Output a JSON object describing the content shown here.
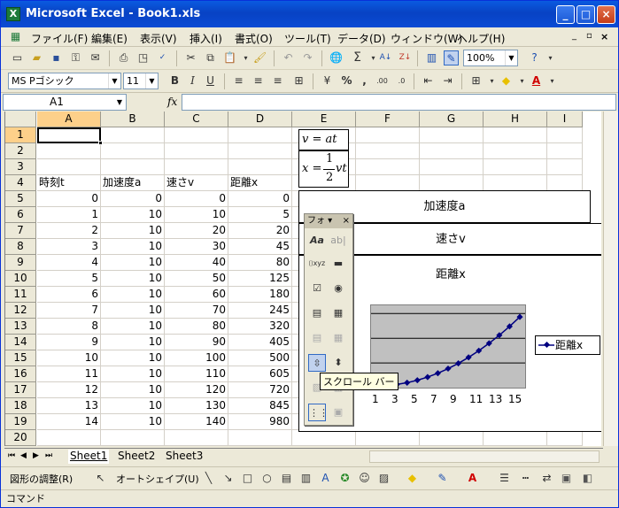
{
  "window": {
    "title": "Microsoft Excel - Book1.xls"
  },
  "menu": [
    "ファイル(F)",
    "編集(E)",
    "表示(V)",
    "挿入(I)",
    "書式(O)",
    "ツール(T)",
    "データ(D)",
    "ウィンドウ(W)",
    "ヘルプ(H)"
  ],
  "toolbar": {
    "zoom": "100%",
    "font": "MS Pゴシック",
    "size": "11"
  },
  "namebox": "A1",
  "fx_label": "fx",
  "columns": [
    "A",
    "B",
    "C",
    "D",
    "E",
    "F",
    "G",
    "H",
    "I"
  ],
  "rows": [
    "1",
    "2",
    "3",
    "4",
    "5",
    "6",
    "7",
    "8",
    "9",
    "10",
    "11",
    "12",
    "13",
    "14",
    "15",
    "16",
    "17",
    "18",
    "19",
    "20"
  ],
  "table": {
    "headers": [
      "時刻t",
      "加速度a",
      "速さv",
      "距離x"
    ],
    "data": [
      [
        0,
        0,
        0,
        0
      ],
      [
        1,
        10,
        10,
        5
      ],
      [
        2,
        10,
        20,
        20
      ],
      [
        3,
        10,
        30,
        45
      ],
      [
        4,
        10,
        40,
        80
      ],
      [
        5,
        10,
        50,
        125
      ],
      [
        6,
        10,
        60,
        180
      ],
      [
        7,
        10,
        70,
        245
      ],
      [
        8,
        10,
        80,
        320
      ],
      [
        9,
        10,
        90,
        405
      ],
      [
        10,
        10,
        100,
        500
      ],
      [
        11,
        10,
        110,
        605
      ],
      [
        12,
        10,
        120,
        720
      ],
      [
        13,
        10,
        130,
        845
      ],
      [
        14,
        10,
        140,
        980
      ]
    ]
  },
  "equations": {
    "v": "v = at",
    "x_left": "x =",
    "x_num": "1",
    "x_den": "2",
    "x_right": "vt"
  },
  "charts": {
    "accel_title": "加速度a",
    "speed_title": "速さv",
    "dist_title": "距離x",
    "legend": "距離x"
  },
  "chart_data": {
    "type": "line",
    "title": "距離x",
    "categories": [
      "1",
      "3",
      "5",
      "7",
      "9",
      "11",
      "13",
      "15"
    ],
    "series": [
      {
        "name": "距離x",
        "values": [
          0,
          5,
          20,
          45,
          80,
          125,
          180,
          245,
          320,
          405,
          500,
          605,
          720,
          845,
          980
        ]
      }
    ]
  },
  "forms_toolbar": {
    "title": "フォ"
  },
  "tooltip": "スクロール バー",
  "sheets": [
    "Sheet1",
    "Sheet2",
    "Sheet3"
  ],
  "drawing": {
    "adjust": "図形の調整(R)",
    "autoshape": "オートシェイプ(U)"
  },
  "status": "コマンド"
}
